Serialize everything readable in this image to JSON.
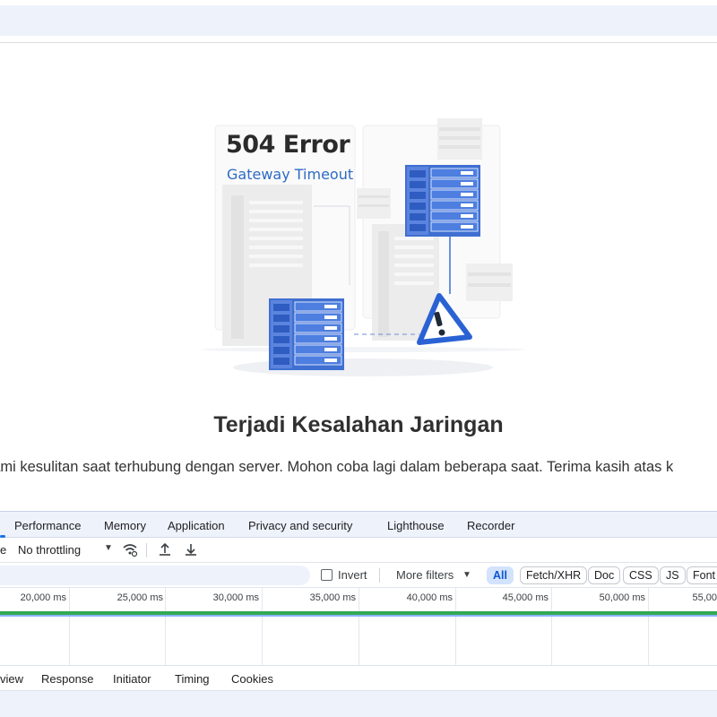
{
  "error_page": {
    "title": "504 Error",
    "subtitle": "Gateway Timeout",
    "heading": "Terjadi Kesalahan Jaringan",
    "message": "ngalami kesulitan saat terhubung dengan server. Mohon coba lagi dalam beberapa saat. Terima kasih atas k"
  },
  "devtools": {
    "tabs": [
      "Performance",
      "Memory",
      "Application",
      "Privacy and security",
      "Lighthouse",
      "Recorder"
    ],
    "toolbar": {
      "preserve_fragment": "e",
      "throttling": "No throttling"
    },
    "filter": {
      "invert_label": "Invert",
      "more_filters": "More filters",
      "chips": [
        "All",
        "Fetch/XHR",
        "Doc",
        "CSS",
        "JS",
        "Font"
      ]
    },
    "timeline_ticks": [
      "20,000 ms",
      "25,000 ms",
      "30,000 ms",
      "35,000 ms",
      "40,000 ms",
      "45,000 ms",
      "50,000 ms",
      "55,00"
    ],
    "detail_tabs": [
      "view",
      "Response",
      "Initiator",
      "Timing",
      "Cookies"
    ]
  }
}
